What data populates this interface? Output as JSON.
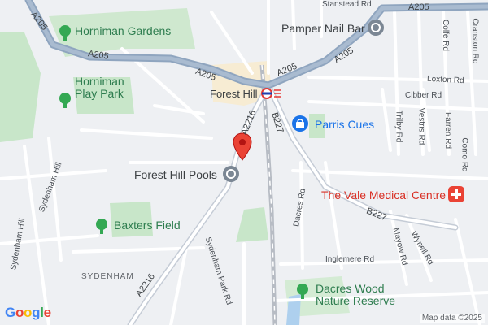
{
  "map": {
    "places": {
      "horniman_gardens": "Horniman Gardens",
      "horniman_play_park": "Horniman Play Park",
      "forest_hill_pools": "Forest Hill Pools",
      "baxters_field": "Baxters Field",
      "forest_hill": "Forest Hill",
      "pamper_nail_bar": "Pamper Nail Bar",
      "parris_cues": "Parris Cues",
      "vale_medical": "The Vale Medical Centre",
      "dacres_wood": "Dacres Wood Nature Reserve",
      "sydenham": "SYDENHAM"
    },
    "roads": {
      "a205_1": "A205",
      "a205_2": "A205",
      "a205_3": "A205",
      "a205_4": "A205",
      "a205_5": "A205",
      "a205_6": "A205",
      "a2216_1": "A2216",
      "a2216_2": "A2216",
      "b227_1": "B227",
      "b227_2": "B227"
    },
    "streets": {
      "stanstead": "Stanstead Rd",
      "loxton": "Loxton Rd",
      "cibber": "Cibber Rd",
      "trilby": "Trilby Rd",
      "vestris": "Vestris Rd",
      "farren": "Farren Rd",
      "colfe": "Colfe Rd",
      "cranston": "Cranston Rd",
      "como": "Como Rd",
      "sydenham_hill_1": "Sydenham Hill",
      "sydenham_hill_2": "Sydenham Hill",
      "dacres": "Dacres Rd",
      "inglemere": "Inglemere Rd",
      "mayow": "Mayow Rd",
      "wynell": "Wynell Rd",
      "sydenham_park": "Sydenham Park Rd"
    },
    "icons": {
      "pin": "location-pin-icon",
      "pool": "pool-icon",
      "nail_bar": "nail-bar-icon",
      "shop": "shopping-bag-icon",
      "medical": "medical-cross-icon",
      "tree": "tree-icon",
      "rail": "rail-station-icon"
    },
    "colors": {
      "pin": "#ea4335",
      "medical": "#ea4335",
      "shop": "#1a73e8",
      "major_road": "#8fa5bf",
      "park": "#c8e6c9"
    },
    "attribution": "Map data ©2025",
    "logo": "Google"
  }
}
